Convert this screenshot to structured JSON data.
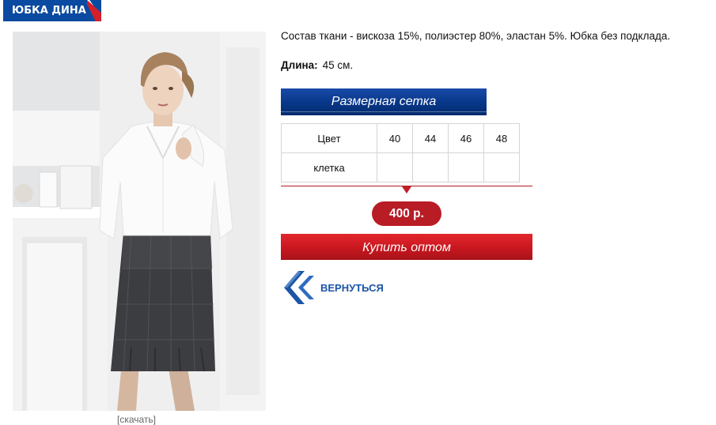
{
  "title": "ЮБКА ДИНА",
  "product": {
    "composition": "Состав ткани - вискоза 15%, полиэстер 80%, эластан 5%. Юбка без подклада.",
    "length_label": "Длина:",
    "length_value": "45 см.",
    "download_link": "[скачать]"
  },
  "size_chart": {
    "banner": "Размерная сетка",
    "header": [
      "Цвет",
      "40",
      "44",
      "46",
      "48"
    ],
    "rows": [
      [
        "клетка",
        "",
        "",
        "",
        ""
      ]
    ]
  },
  "price": "400 р.",
  "buy_button": "Купить оптом",
  "back_button": "ВЕРНУТЬСЯ",
  "colors": {
    "brand_blue": "#0a4aa0",
    "accent_red": "#c8171f",
    "link_blue": "#1d55a6"
  }
}
